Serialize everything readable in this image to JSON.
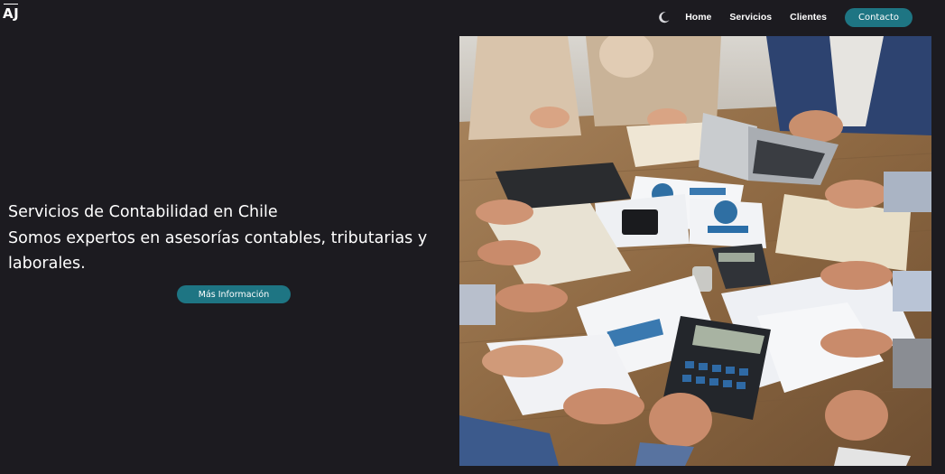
{
  "header": {
    "logo": "AJ",
    "theme_toggle_icon": "moon-icon",
    "nav": [
      {
        "label": "Home"
      },
      {
        "label": "Servicios"
      },
      {
        "label": "Clientes"
      }
    ],
    "cta_label": "Contacto"
  },
  "hero": {
    "title": "Servicios de Contabilidad en Chile",
    "subtitle": "Somos expertos en asesorías contables, tributarias y laborales.",
    "button_label": "Más Información",
    "image_icon": "accounting-team-photo"
  },
  "colors": {
    "background": "#1c1b20",
    "accent": "#1e7583",
    "text": "#ffffff"
  }
}
